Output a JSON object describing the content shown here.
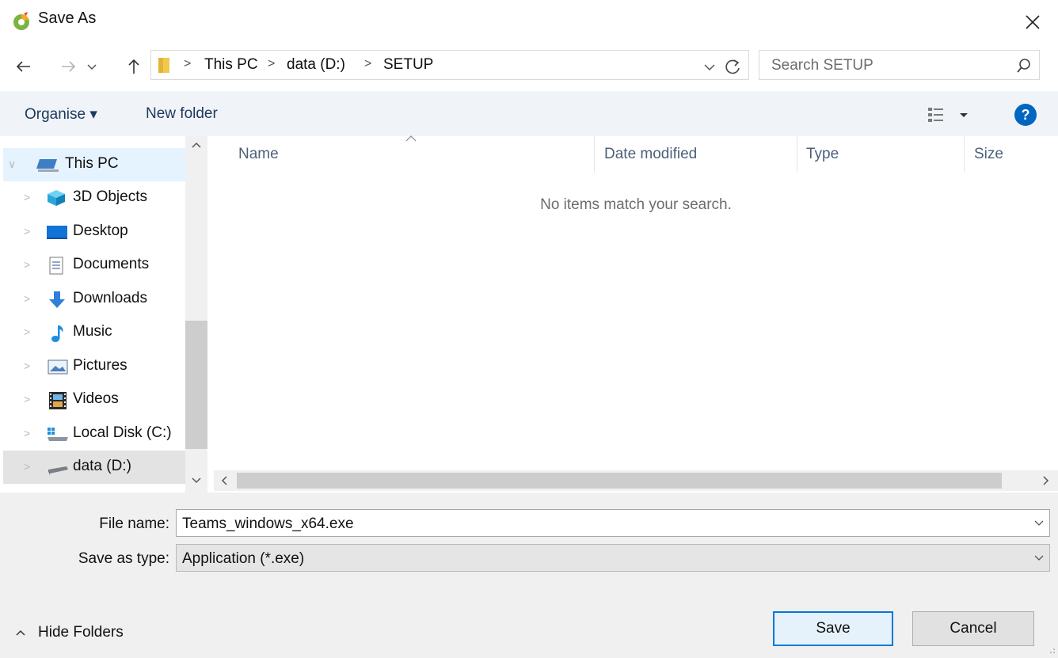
{
  "window": {
    "title": "Save As"
  },
  "address_bar": {
    "breadcrumbs": [
      "This PC",
      "data (D:)",
      "SETUP"
    ]
  },
  "search": {
    "placeholder": "Search SETUP"
  },
  "toolbar": {
    "organise_label": "Organise ▾",
    "new_folder_label": "New folder"
  },
  "nav_pane": {
    "items": [
      {
        "label": "This PC",
        "icon": "computer-icon"
      },
      {
        "label": "3D Objects",
        "icon": "cube-icon"
      },
      {
        "label": "Desktop",
        "icon": "desktop-icon"
      },
      {
        "label": "Documents",
        "icon": "document-icon"
      },
      {
        "label": "Downloads",
        "icon": "download-arrow-icon"
      },
      {
        "label": "Music",
        "icon": "music-note-icon"
      },
      {
        "label": "Pictures",
        "icon": "picture-icon"
      },
      {
        "label": "Videos",
        "icon": "video-icon"
      },
      {
        "label": "Local Disk (C:)",
        "icon": "windows-drive-icon"
      },
      {
        "label": "data (D:)",
        "icon": "drive-icon"
      }
    ]
  },
  "file_list": {
    "columns": [
      "Name",
      "Date modified",
      "Type",
      "Size"
    ],
    "empty_message": "No items match your search."
  },
  "form": {
    "file_name_label": "File name:",
    "file_name_value": "Teams_windows_x64.exe",
    "save_type_label": "Save as type:",
    "save_type_value": "Application (*.exe)"
  },
  "buttons": {
    "save": "Save",
    "cancel": "Cancel",
    "hide_folders": "Hide Folders"
  },
  "colors": {
    "accent": "#0078d7",
    "toolbar_bg": "#f0f4f9",
    "selected_row": "#e5f3ff",
    "help": "#0067c0"
  }
}
